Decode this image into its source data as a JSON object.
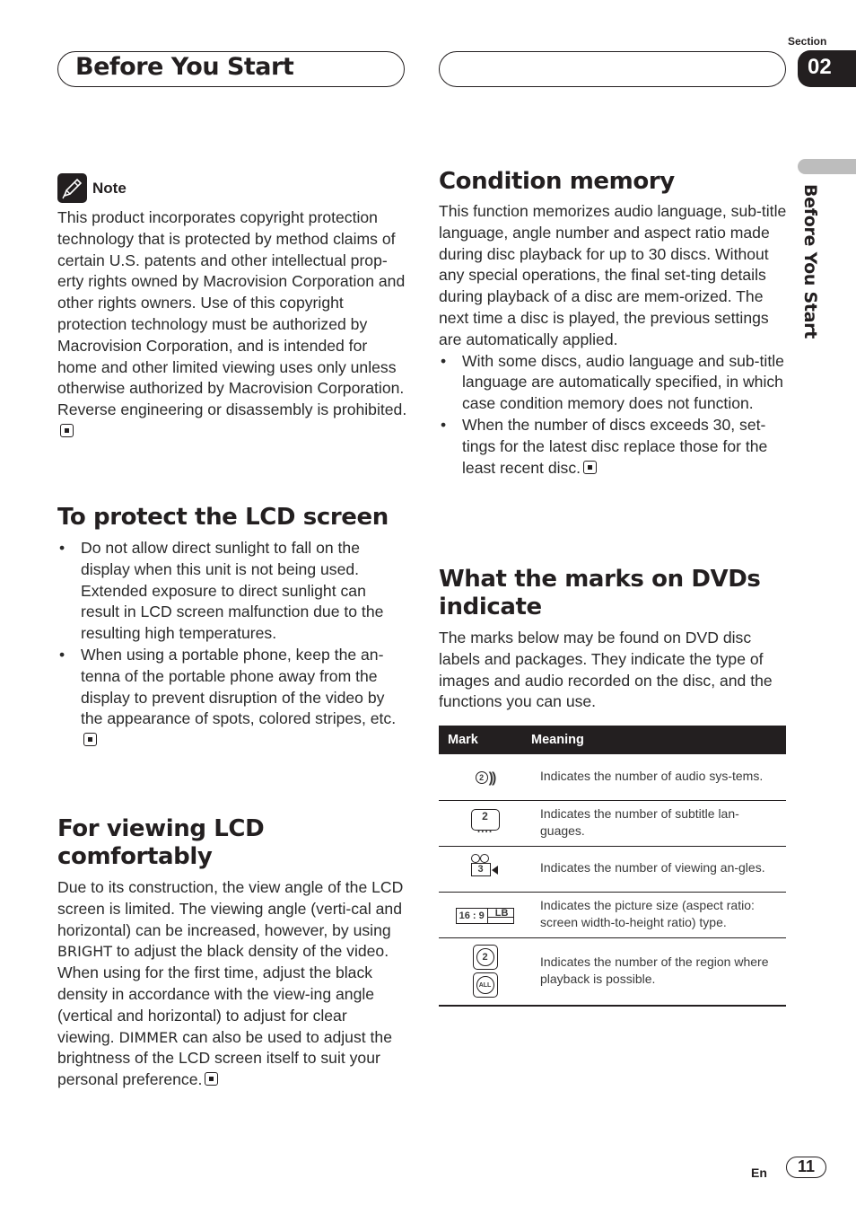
{
  "header": {
    "title": "Before You Start",
    "section_label": "Section",
    "section_number": "02",
    "side_tab_text": "Before You Start"
  },
  "note": {
    "label": "Note",
    "icon": "pencil-icon",
    "text": "This product incorporates copyright protection technology that is protected by method claims of certain U.S. patents and other intellectual prop-erty rights owned by Macrovision Corporation and other rights owners. Use of this copyright protection technology must be authorized by Macrovision Corporation, and is intended for home and other limited viewing uses only unless otherwise authorized by Macrovision Corporation. Reverse engineering or disassembly is prohibited."
  },
  "protect_lcd": {
    "heading": "To protect the LCD screen",
    "bullets": [
      "Do not allow direct sunlight to fall on the display when this unit is not being used. Extended exposure to direct sunlight can result in LCD screen malfunction due to the resulting high temperatures.",
      "When using a portable phone, keep the an-tenna of the portable phone away from the display to prevent disruption of the video by the appearance of spots, colored stripes, etc."
    ]
  },
  "viewing_lcd": {
    "heading": "For viewing LCD comfortably",
    "text_1": "Due to its construction, the view angle of the LCD screen is limited. The viewing angle (verti-cal and horizontal) can be increased, however, by using ",
    "bold_1": "BRIGHT",
    "text_2": " to adjust the black density of the video. When using for the first time, adjust the black density in accordance with the view-ing angle (vertical and horizontal) to adjust for clear viewing. ",
    "bold_2": "DIMMER",
    "text_3": " can also be used to adjust the brightness of the LCD screen itself to suit your personal preference."
  },
  "condition_memory": {
    "heading": "Condition memory",
    "text": "This function memorizes audio language, sub-title language, angle number and aspect ratio made during disc playback for up to 30 discs. Without any special operations, the final set-ting details during playback of a disc are mem-orized. The next time a disc is played, the previous settings are automatically applied.",
    "bullets": [
      "With some discs, audio language and sub-title language are automatically specified, in which case condition memory does not function.",
      "When the number of discs exceeds 30, set-tings for the latest disc replace those for the least recent disc."
    ]
  },
  "dvd_marks": {
    "heading": "What the marks on DVDs indicate",
    "intro": "The marks below may be found on DVD disc labels and packages. They indicate the type of images and audio recorded on the disc, and the functions you can use.",
    "table": {
      "columns": [
        "Mark",
        "Meaning"
      ],
      "rows": [
        {
          "mark": "audio-systems-icon",
          "mark_text": "2",
          "meaning": "Indicates the number of audio sys-tems."
        },
        {
          "mark": "subtitle-languages-icon",
          "mark_text": "2",
          "meaning": "Indicates the number of subtitle lan-guages."
        },
        {
          "mark": "viewing-angles-icon",
          "mark_text": "3",
          "meaning": "Indicates the number of viewing an-gles."
        },
        {
          "mark": "aspect-ratio-icon",
          "mark_text": "16 : 9",
          "mark_text_2": "LB",
          "meaning": "Indicates the picture size (aspect ratio: screen width-to-height ratio) type."
        },
        {
          "mark": "region-icon",
          "mark_text": "2",
          "mark_text_2": "ALL",
          "meaning": "Indicates the number of the region where playback is possible."
        }
      ]
    }
  },
  "footer": {
    "language": "En",
    "page_number": "11"
  }
}
